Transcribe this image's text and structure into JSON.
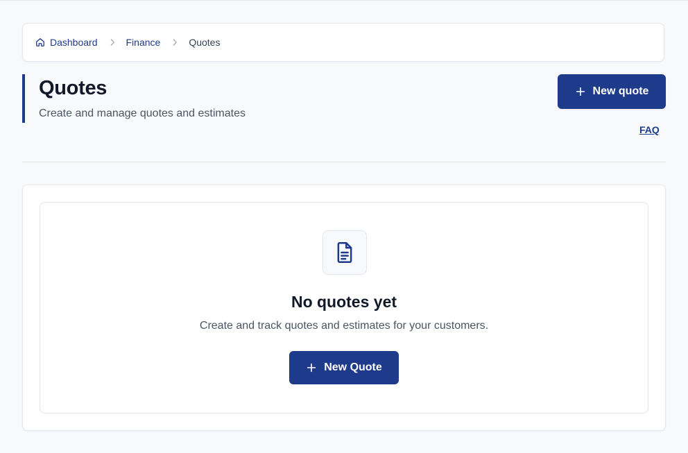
{
  "breadcrumb": {
    "items": [
      {
        "label": "Dashboard",
        "icon": "home-icon"
      },
      {
        "label": "Finance"
      },
      {
        "label": "Quotes"
      }
    ],
    "separator_icon": "chevron-right-icon"
  },
  "header": {
    "title": "Quotes",
    "subtitle": "Create and manage quotes and estimates",
    "new_button_label": "New quote",
    "new_button_icon": "plus-icon",
    "faq_label": "FAQ"
  },
  "empty_state": {
    "icon": "document-icon",
    "title": "No quotes yet",
    "description": "Create and track quotes and estimates for your customers.",
    "button_label": "New Quote",
    "button_icon": "plus-icon"
  },
  "colors": {
    "primary": "#1e3a8a",
    "background": "#f8f9fb",
    "card": "#ffffff",
    "border": "#e3e6eb",
    "text_primary": "#111827",
    "text_secondary": "#4b5563"
  }
}
